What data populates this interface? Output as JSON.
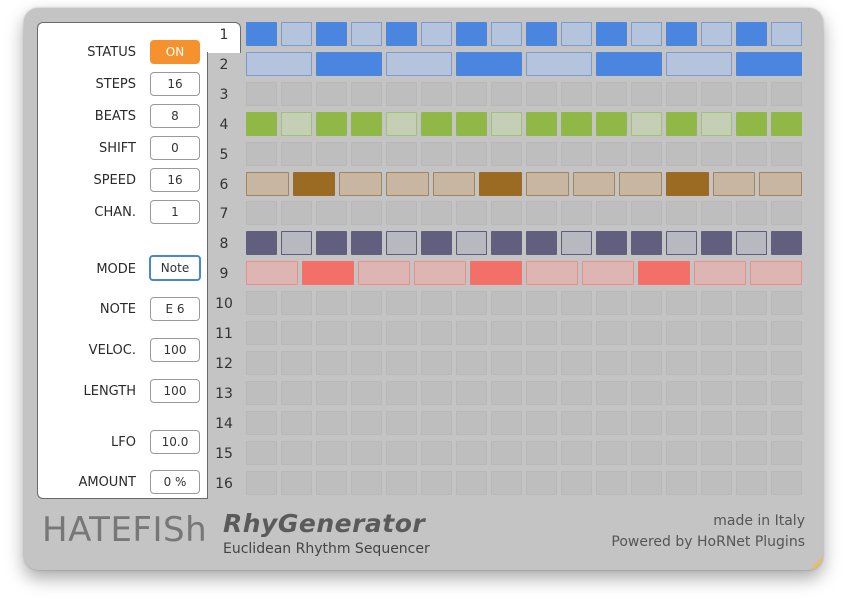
{
  "params": {
    "status": {
      "label": "STATUS",
      "value": "ON"
    },
    "steps": {
      "label": "STEPS",
      "value": "16"
    },
    "beats": {
      "label": "BEATS",
      "value": "8"
    },
    "shift": {
      "label": "SHIFT",
      "value": "0"
    },
    "speed": {
      "label": "SPEED",
      "value": "16"
    },
    "chan": {
      "label": "CHAN.",
      "value": "1"
    },
    "mode": {
      "label": "MODE",
      "value": "Note"
    },
    "note": {
      "label": "NOTE",
      "value": "E 6"
    },
    "veloc": {
      "label": "VELOC.",
      "value": "100"
    },
    "length": {
      "label": "LENGTH",
      "value": "100"
    },
    "lfo": {
      "label": "LFO",
      "value": "10.0"
    },
    "amount": {
      "label": "AMOUNT",
      "value": "0 %"
    }
  },
  "rows": [
    {
      "num": "1",
      "steps": 16,
      "pattern": [
        1,
        0,
        1,
        0,
        1,
        0,
        1,
        0,
        1,
        0,
        1,
        0,
        1,
        0,
        1,
        0
      ],
      "active_color": "#4a86e0",
      "inactive_fill": "#b4c4dc",
      "inactive_border": "#7b9ad0"
    },
    {
      "num": "2",
      "steps": 8,
      "pattern": [
        0,
        1,
        0,
        1,
        0,
        1,
        0,
        1
      ],
      "active_color": "#4a86e0",
      "inactive_fill": "#b4c4dc",
      "inactive_border": "#7b9ad0"
    },
    {
      "num": "3",
      "steps": 16,
      "pattern": [],
      "active_color": "#bdbdbd",
      "inactive_fill": "#bdbdbd",
      "inactive_border": "#bdbdbd"
    },
    {
      "num": "4",
      "steps": 16,
      "pattern": [
        1,
        0,
        1,
        1,
        0,
        1,
        1,
        0,
        1,
        1,
        1,
        0,
        1,
        0,
        1,
        1
      ],
      "active_color": "#8fb847",
      "inactive_fill": "#c4cfb6",
      "inactive_border": "#9fc271"
    },
    {
      "num": "5",
      "steps": 16,
      "pattern": [],
      "active_color": "#bdbdbd",
      "inactive_fill": "#bdbdbd",
      "inactive_border": "#bdbdbd"
    },
    {
      "num": "6",
      "steps": 12,
      "pattern": [
        0,
        1,
        0,
        0,
        0,
        1,
        0,
        0,
        0,
        1,
        0,
        0
      ],
      "active_color": "#9b6a23",
      "inactive_fill": "#c6b6a2",
      "inactive_border": "#a4845c"
    },
    {
      "num": "7",
      "steps": 16,
      "pattern": [],
      "active_color": "#bdbdbd",
      "inactive_fill": "#bdbdbd",
      "inactive_border": "#bdbdbd"
    },
    {
      "num": "8",
      "steps": 16,
      "pattern": [
        1,
        0,
        1,
        1,
        0,
        1,
        0,
        1,
        1,
        0,
        1,
        1,
        0,
        1,
        0,
        1
      ],
      "active_color": "#615e7e",
      "inactive_fill": "#b8b8c0",
      "inactive_border": "#5f5c7a"
    },
    {
      "num": "9",
      "steps": 10,
      "pattern": [
        0,
        1,
        0,
        0,
        1,
        0,
        0,
        1,
        0,
        0
      ],
      "active_color": "#f27068",
      "inactive_fill": "#ddb5b2",
      "inactive_border": "#ec8e86"
    },
    {
      "num": "10",
      "steps": 16,
      "pattern": [],
      "active_color": "#bdbdbd",
      "inactive_fill": "#bdbdbd",
      "inactive_border": "#bdbdbd"
    },
    {
      "num": "11",
      "steps": 16,
      "pattern": [],
      "active_color": "#bdbdbd",
      "inactive_fill": "#bdbdbd",
      "inactive_border": "#bdbdbd"
    },
    {
      "num": "12",
      "steps": 16,
      "pattern": [],
      "active_color": "#bdbdbd",
      "inactive_fill": "#bdbdbd",
      "inactive_border": "#bdbdbd"
    },
    {
      "num": "13",
      "steps": 16,
      "pattern": [],
      "active_color": "#bdbdbd",
      "inactive_fill": "#bdbdbd",
      "inactive_border": "#bdbdbd"
    },
    {
      "num": "14",
      "steps": 16,
      "pattern": [],
      "active_color": "#bdbdbd",
      "inactive_fill": "#bdbdbd",
      "inactive_border": "#bdbdbd"
    },
    {
      "num": "15",
      "steps": 16,
      "pattern": [],
      "active_color": "#bdbdbd",
      "inactive_fill": "#bdbdbd",
      "inactive_border": "#bdbdbd"
    },
    {
      "num": "16",
      "steps": 16,
      "pattern": [],
      "active_color": "#bdbdbd",
      "inactive_fill": "#bdbdbd",
      "inactive_border": "#bdbdbd"
    }
  ],
  "footer": {
    "brand": "HATEFISh",
    "product": "RhyGenerator",
    "tagline": "Euclidean Rhythm Sequencer",
    "made_in": "made in Italy",
    "powered_by": "Powered by HoRNet Plugins"
  },
  "colors": {
    "background": "#c4c4c4",
    "panel": "#ffffff",
    "status_on": "#f6922e",
    "mode_border": "#4a86d8"
  }
}
